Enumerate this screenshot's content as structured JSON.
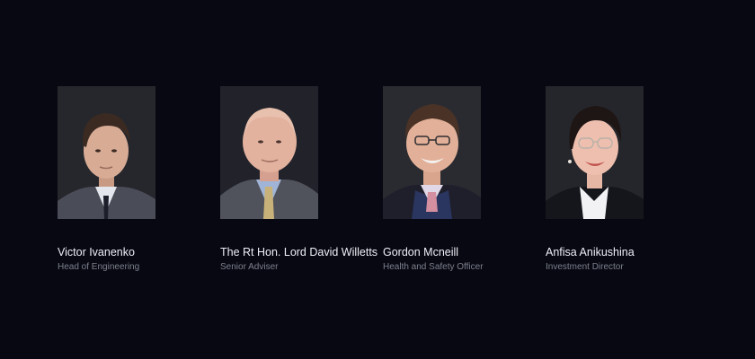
{
  "team": {
    "members": [
      {
        "name": "Victor Ivanenko",
        "role": "Head of Engineering",
        "photo_icon": "portrait-photo"
      },
      {
        "name": "The Rt Hon. Lord David Willetts",
        "role": "Senior Adviser",
        "photo_icon": "portrait-photo"
      },
      {
        "name": "Gordon Mcneill",
        "role": "Health and Safety Officer",
        "photo_icon": "portrait-photo"
      },
      {
        "name": "Anfisa Anikushina",
        "role": "Investment Director",
        "photo_icon": "portrait-photo"
      }
    ]
  },
  "colors": {
    "background": "#070812",
    "name_text": "#eef0f6",
    "role_text": "#7d818d",
    "photo_backdrop": "#24252b"
  }
}
